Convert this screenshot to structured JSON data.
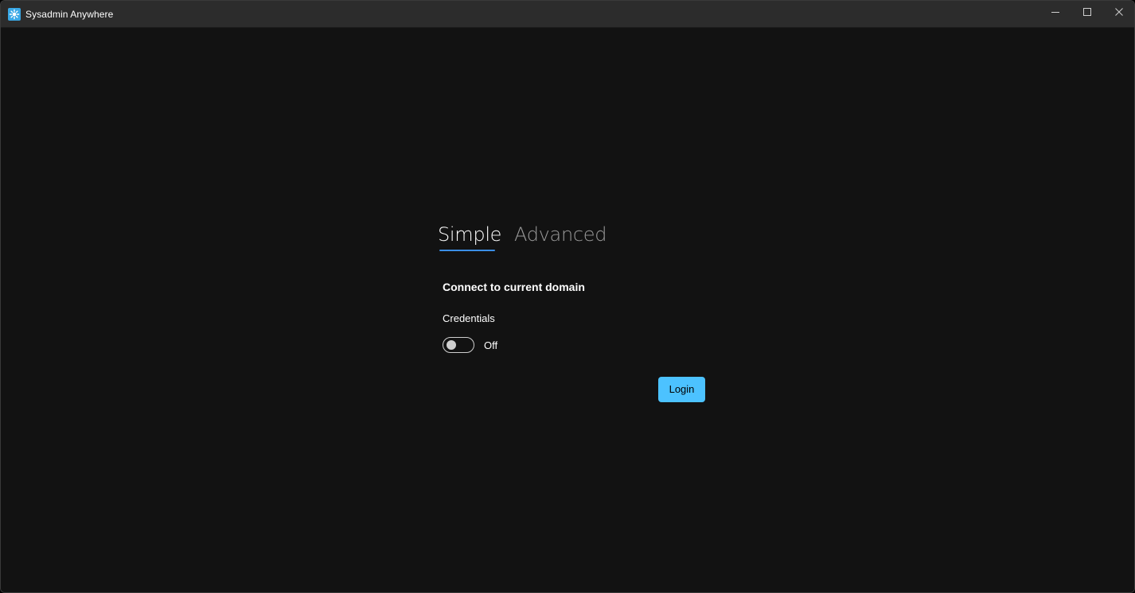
{
  "window": {
    "title": "Sysadmin Anywhere",
    "app_icon": "gear-icon",
    "controls": {
      "minimize_icon": "minimize-icon",
      "maximize_icon": "maximize-icon",
      "close_icon": "close-icon"
    }
  },
  "tabs": [
    {
      "label": "Simple",
      "selected": true
    },
    {
      "label": "Advanced",
      "selected": false
    }
  ],
  "simple": {
    "section_title": "Connect to current domain",
    "credentials_label": "Credentials",
    "toggle_state": "Off",
    "toggle_on": false,
    "login_label": "Login"
  },
  "colors": {
    "background": "#121212",
    "titlebar": "#2c2c2c",
    "accent": "#4cc2ff",
    "tab_underline": "#3a8ee6",
    "inactive_tab": "#9a9a9a"
  }
}
